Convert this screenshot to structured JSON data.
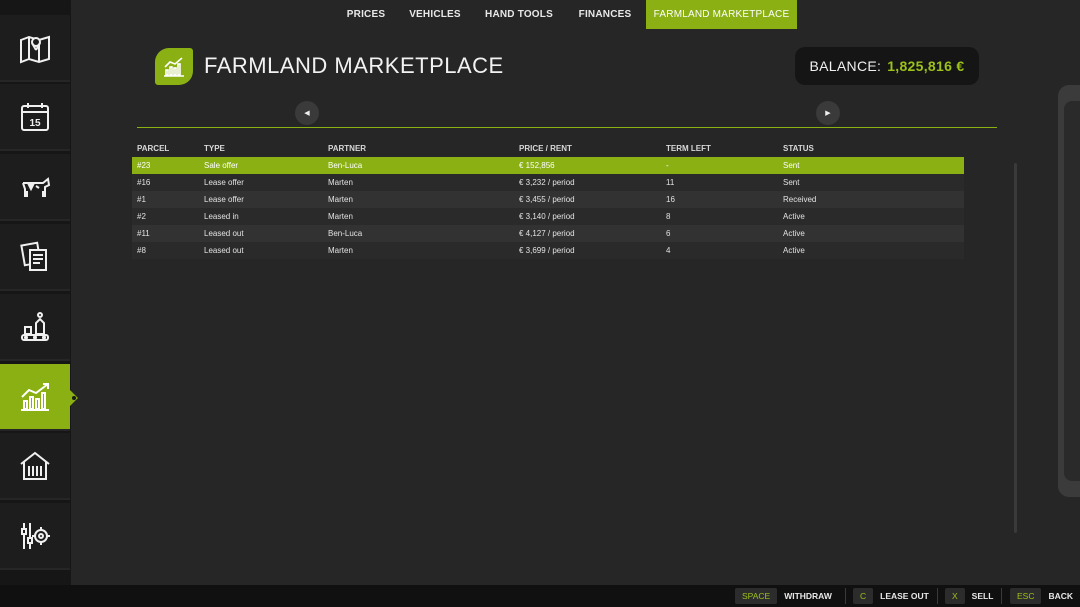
{
  "sidebar": {
    "items": [
      {
        "icon": "map-icon"
      },
      {
        "icon": "calendar-icon",
        "text": "15"
      },
      {
        "icon": "livestock-icon"
      },
      {
        "icon": "contracts-icon"
      },
      {
        "icon": "production-icon"
      },
      {
        "icon": "prices-chart-icon",
        "active": true
      },
      {
        "icon": "animal-pens-icon"
      },
      {
        "icon": "settings-icon"
      }
    ]
  },
  "header": {
    "title": "FARMLAND MARKETPLACE",
    "balance_label": "BALANCE:",
    "balance_value": "1,825,816 €"
  },
  "tabs": [
    "PRICES",
    "VEHICLES",
    "HAND TOOLS",
    "FINANCES",
    "FARMLAND MARKETPLACE"
  ],
  "table": {
    "columns": [
      "PARCEL",
      "TYPE",
      "PARTNER",
      "PRICE / RENT",
      "TERM LEFT",
      "STATUS"
    ],
    "rows": [
      [
        "#23",
        "Sale offer",
        "Ben-Luca",
        "€ 152,856",
        "-",
        "Sent"
      ],
      [
        "#16",
        "Lease offer",
        "Marten",
        "€ 3,232 / period",
        "11",
        "Sent"
      ],
      [
        "#1",
        "Lease offer",
        "Marten",
        "€ 3,455 / period",
        "16",
        "Received"
      ],
      [
        "#2",
        "Leased in",
        "Marten",
        "€ 3,140 / period",
        "8",
        "Active"
      ],
      [
        "#11",
        "Leased out",
        "Ben-Luca",
        "€ 4,127 / period",
        "6",
        "Active"
      ],
      [
        "#8",
        "Leased out",
        "Marten",
        "€ 3,699 / period",
        "4",
        "Active"
      ]
    ]
  },
  "footer": {
    "hints": [
      {
        "key": "SPACE",
        "label": "WITHDRAW"
      },
      {
        "key": "C",
        "label": "LEASE OUT"
      },
      {
        "key": "X",
        "label": "SELL"
      },
      {
        "key": "ESC",
        "label": "BACK"
      }
    ]
  },
  "colors": {
    "accent": "#8ab014",
    "balance_green": "#9cc21a",
    "background": "#262626"
  }
}
